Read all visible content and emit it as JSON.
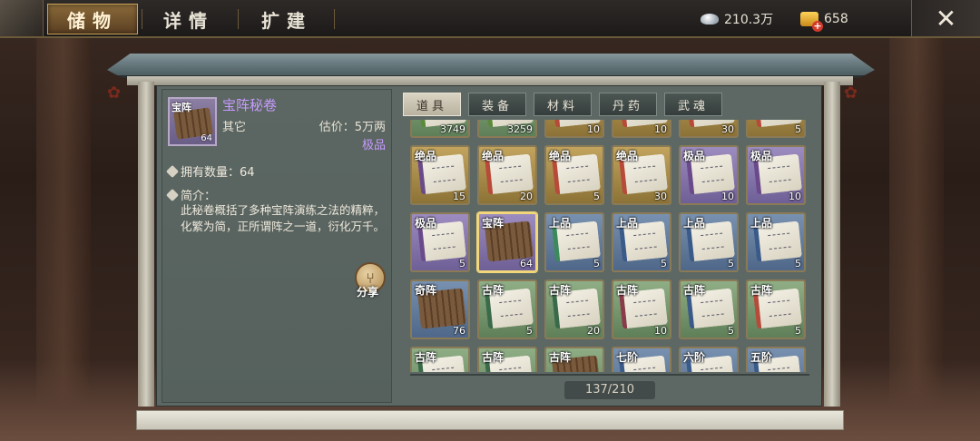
{
  "topbar": {
    "tabs": [
      {
        "label": "储物",
        "active": true
      },
      {
        "label": "详情",
        "active": false
      },
      {
        "label": "扩建",
        "active": false
      }
    ],
    "silver": "210.3万",
    "gold": "658"
  },
  "detail": {
    "thumb_tag": "宝阵",
    "thumb_count": "64",
    "name": "宝阵秘卷",
    "category": "其它",
    "price": "估价：5万两",
    "grade": "极品",
    "owned": "拥有数量：64",
    "desc_title": "简介：",
    "description": "此秘卷概括了多种宝阵演练之法的精粹，化繁为简，正所谓阵之一道，衍化万千。",
    "share_label": "分享"
  },
  "categories": [
    {
      "label": "道具",
      "active": true
    },
    {
      "label": "装备",
      "active": false
    },
    {
      "label": "材料",
      "active": false
    },
    {
      "label": "丹药",
      "active": false
    },
    {
      "label": "武魂",
      "active": false
    }
  ],
  "grid": [
    {
      "tag": "",
      "count": "3749",
      "grade": "green",
      "ribbon": "#5b8a3a"
    },
    {
      "tag": "",
      "count": "3259",
      "grade": "green",
      "ribbon": "#5b8a3a"
    },
    {
      "tag": "",
      "count": "10",
      "grade": "gold",
      "ribbon": "#b84a3a"
    },
    {
      "tag": "",
      "count": "10",
      "grade": "gold",
      "ribbon": "#b84a3a"
    },
    {
      "tag": "",
      "count": "30",
      "grade": "gold",
      "ribbon": "#b84a3a"
    },
    {
      "tag": "",
      "count": "5",
      "grade": "gold",
      "ribbon": "#b84a3a"
    },
    {
      "tag": "绝品",
      "count": "15",
      "grade": "gold",
      "ribbon": "#6a4a8a"
    },
    {
      "tag": "绝品",
      "count": "20",
      "grade": "gold",
      "ribbon": "#b84a3a"
    },
    {
      "tag": "绝品",
      "count": "5",
      "grade": "gold",
      "ribbon": "#b84a3a"
    },
    {
      "tag": "绝品",
      "count": "30",
      "grade": "gold",
      "ribbon": "#b84a3a"
    },
    {
      "tag": "极品",
      "count": "10",
      "grade": "purple",
      "ribbon": "#6a4a8a"
    },
    {
      "tag": "极品",
      "count": "10",
      "grade": "purple",
      "ribbon": "#6a4a8a"
    },
    {
      "tag": "极品",
      "count": "5",
      "grade": "purple",
      "ribbon": "#6a4a8a"
    },
    {
      "tag": "宝阵",
      "count": "64",
      "grade": "purple",
      "ribbon": "",
      "wood": true,
      "selected": true
    },
    {
      "tag": "上品",
      "count": "5",
      "grade": "blue",
      "ribbon": "#3a8a5a"
    },
    {
      "tag": "上品",
      "count": "5",
      "grade": "blue",
      "ribbon": "#3a5a8a"
    },
    {
      "tag": "上品",
      "count": "5",
      "grade": "blue",
      "ribbon": "#3a5a8a"
    },
    {
      "tag": "上品",
      "count": "5",
      "grade": "blue",
      "ribbon": "#3a5a8a"
    },
    {
      "tag": "奇阵",
      "count": "76",
      "grade": "blue",
      "ribbon": "",
      "wood": true
    },
    {
      "tag": "古阵",
      "count": "5",
      "grade": "green",
      "ribbon": "#3a6a4a"
    },
    {
      "tag": "古阵",
      "count": "20",
      "grade": "green",
      "ribbon": "#3a6a4a"
    },
    {
      "tag": "古阵",
      "count": "10",
      "grade": "green",
      "ribbon": "#8a3a4a"
    },
    {
      "tag": "古阵",
      "count": "5",
      "grade": "green",
      "ribbon": "#3a5a8a"
    },
    {
      "tag": "古阵",
      "count": "5",
      "grade": "green",
      "ribbon": "#b84a3a"
    },
    {
      "tag": "古阵",
      "count": "",
      "grade": "green",
      "ribbon": "#3a6a4a"
    },
    {
      "tag": "古阵",
      "count": "",
      "grade": "green",
      "ribbon": "#3a6a4a"
    },
    {
      "tag": "古阵",
      "count": "",
      "grade": "green",
      "ribbon": "",
      "wood": true
    },
    {
      "tag": "七阶",
      "count": "",
      "grade": "blue",
      "ribbon": "#3a5a8a"
    },
    {
      "tag": "六阶",
      "count": "",
      "grade": "blue",
      "ribbon": "#3a5a8a"
    },
    {
      "tag": "五阶",
      "count": "",
      "grade": "blue",
      "ribbon": "#3a5a8a"
    }
  ],
  "capacity": "137/210"
}
